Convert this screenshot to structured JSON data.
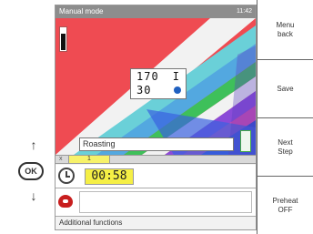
{
  "titlebar": {
    "title": "Manual mode",
    "right_text": "11:42"
  },
  "readout": {
    "row1_value": "170",
    "row1_unit": "I",
    "row2_value": "30"
  },
  "status": {
    "text": "Roasting"
  },
  "tabs": {
    "close_label": "x",
    "active_label": "1"
  },
  "timer": {
    "value": "00:58"
  },
  "footer": {
    "additional_label": "Additional functions"
  },
  "hardware": {
    "ok_label": "OK",
    "up_glyph": "↑",
    "down_glyph": "↓"
  },
  "softkeys": [
    {
      "label": "Menu\nback"
    },
    {
      "label": "Save"
    },
    {
      "label": "Next\nStep"
    },
    {
      "label": "Preheat\nOFF"
    }
  ],
  "colors": {
    "accent": "#f5ef45",
    "graphic_red": "#ef4b52",
    "probe_red": "#c81e1e"
  }
}
